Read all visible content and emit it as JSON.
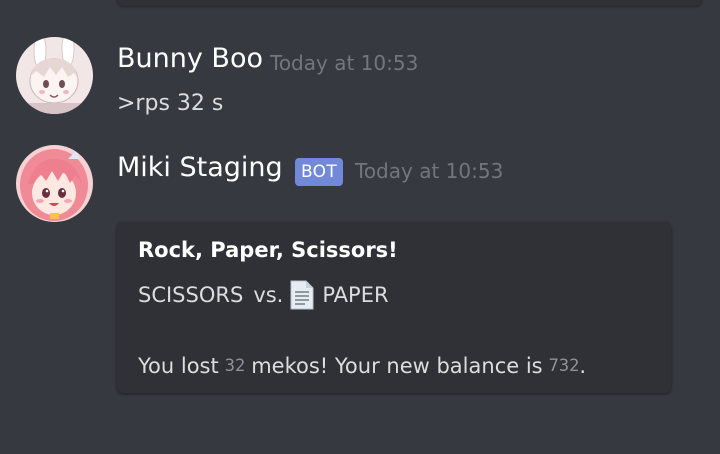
{
  "messages": [
    {
      "author": "Bunny Boo",
      "timestamp": "Today at 10:53",
      "content": ">rps 32 s"
    },
    {
      "author": "Miki Staging",
      "bot_tag": "BOT",
      "timestamp": "Today at 10:53",
      "embed": {
        "title": "Rock, Paper, Scissors!",
        "line1": {
          "left": "SCISSORS",
          "vs": "vs.",
          "icon": "page-facing-up-icon",
          "right": "PAPER"
        },
        "result": {
          "prefix": "You lost",
          "amount": "32",
          "middle": "mekos! Your new balance is",
          "balance": "732",
          "suffix": "."
        }
      }
    }
  ],
  "colors": {
    "background": "#36393f",
    "embed_background": "#2f3136",
    "bot_tag": "#7289da",
    "timestamp": "#72767d",
    "text": "#dcddde",
    "username": "#ffffff"
  }
}
